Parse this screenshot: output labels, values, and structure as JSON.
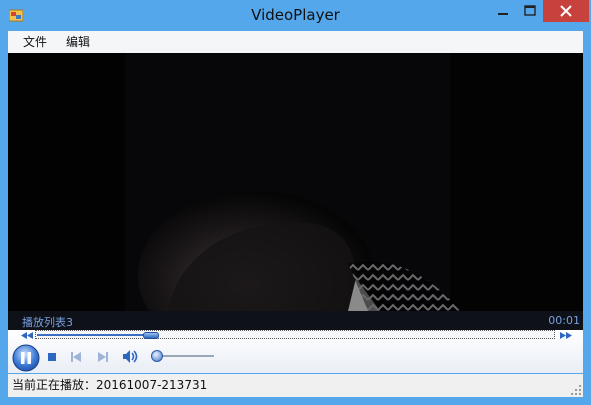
{
  "window": {
    "title": "VideoPlayer"
  },
  "menu": {
    "items": [
      {
        "label": "文件"
      },
      {
        "label": "编辑"
      }
    ]
  },
  "player": {
    "playlist_label": "播放列表3",
    "time": "00:01",
    "seek_progress": 0.22,
    "volume_level": 0.05
  },
  "status": {
    "text": "当前正在播放：20161007-213731"
  },
  "colors": {
    "accent": "#3a6fc2",
    "titlebar": "#55a7eb",
    "close": "#c7413d",
    "label": "#78a0e0"
  },
  "icons": {
    "app": "app-icon",
    "minimize": "minimize-icon",
    "maximize": "maximize-icon",
    "close": "close-icon",
    "rewind": "rewind-icon",
    "fast_forward": "fast-forward-icon",
    "pause": "pause-icon",
    "stop": "stop-icon",
    "previous": "previous-icon",
    "next": "next-icon",
    "volume": "volume-icon",
    "grip": "resize-grip-icon"
  }
}
